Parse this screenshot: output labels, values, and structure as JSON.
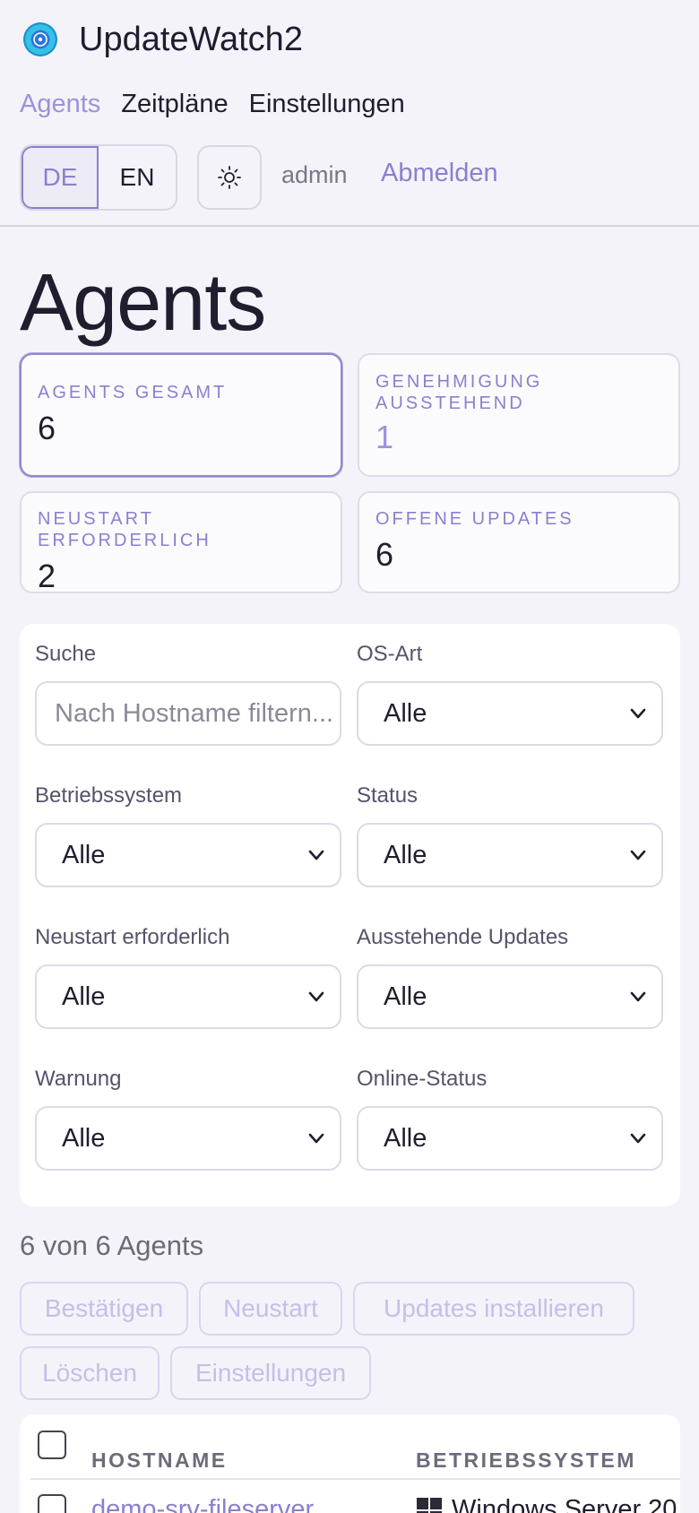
{
  "app": {
    "title": "UpdateWatch2"
  },
  "nav": {
    "items": [
      "Agents",
      "Zeitpläne",
      "Einstellungen"
    ],
    "active": "Agents"
  },
  "language": {
    "options": [
      "DE",
      "EN"
    ],
    "selected": "DE"
  },
  "user": {
    "name": "admin",
    "logout_label": "Abmelden"
  },
  "page": {
    "title": "Agents"
  },
  "stats": [
    {
      "label": "AGENTS GESAMT",
      "value": "6"
    },
    {
      "label": "GENEHMIGUNG AUSSTEHEND",
      "value": "1"
    },
    {
      "label": "NEUSTART ERFORDERLICH",
      "value": "2"
    },
    {
      "label": "OFFENE UPDATES",
      "value": "6"
    }
  ],
  "filters": {
    "search": {
      "label": "Suche",
      "placeholder": "Nach Hostname filtern..."
    },
    "os_type": {
      "label": "OS-Art",
      "value": "Alle"
    },
    "os": {
      "label": "Betriebssystem",
      "value": "Alle"
    },
    "status": {
      "label": "Status",
      "value": "Alle"
    },
    "reboot": {
      "label": "Neustart erforderlich",
      "value": "Alle"
    },
    "pending": {
      "label": "Ausstehende Updates",
      "value": "Alle"
    },
    "warning": {
      "label": "Warnung",
      "value": "Alle"
    },
    "online": {
      "label": "Online-Status",
      "value": "Alle"
    }
  },
  "results": {
    "count_text": "6 von 6 Agents"
  },
  "actions": [
    "Bestätigen",
    "Neustart",
    "Updates installieren",
    "Löschen",
    "Einstellungen"
  ],
  "table": {
    "columns": [
      "HOSTNAME",
      "BETRIEBSSYSTEM"
    ],
    "rows": [
      {
        "hostname": "demo-srv-fileserver",
        "os": "Windows Server 20"
      }
    ]
  },
  "colors": {
    "accent": "#8b7fd0",
    "background": "#f4f3f9"
  }
}
